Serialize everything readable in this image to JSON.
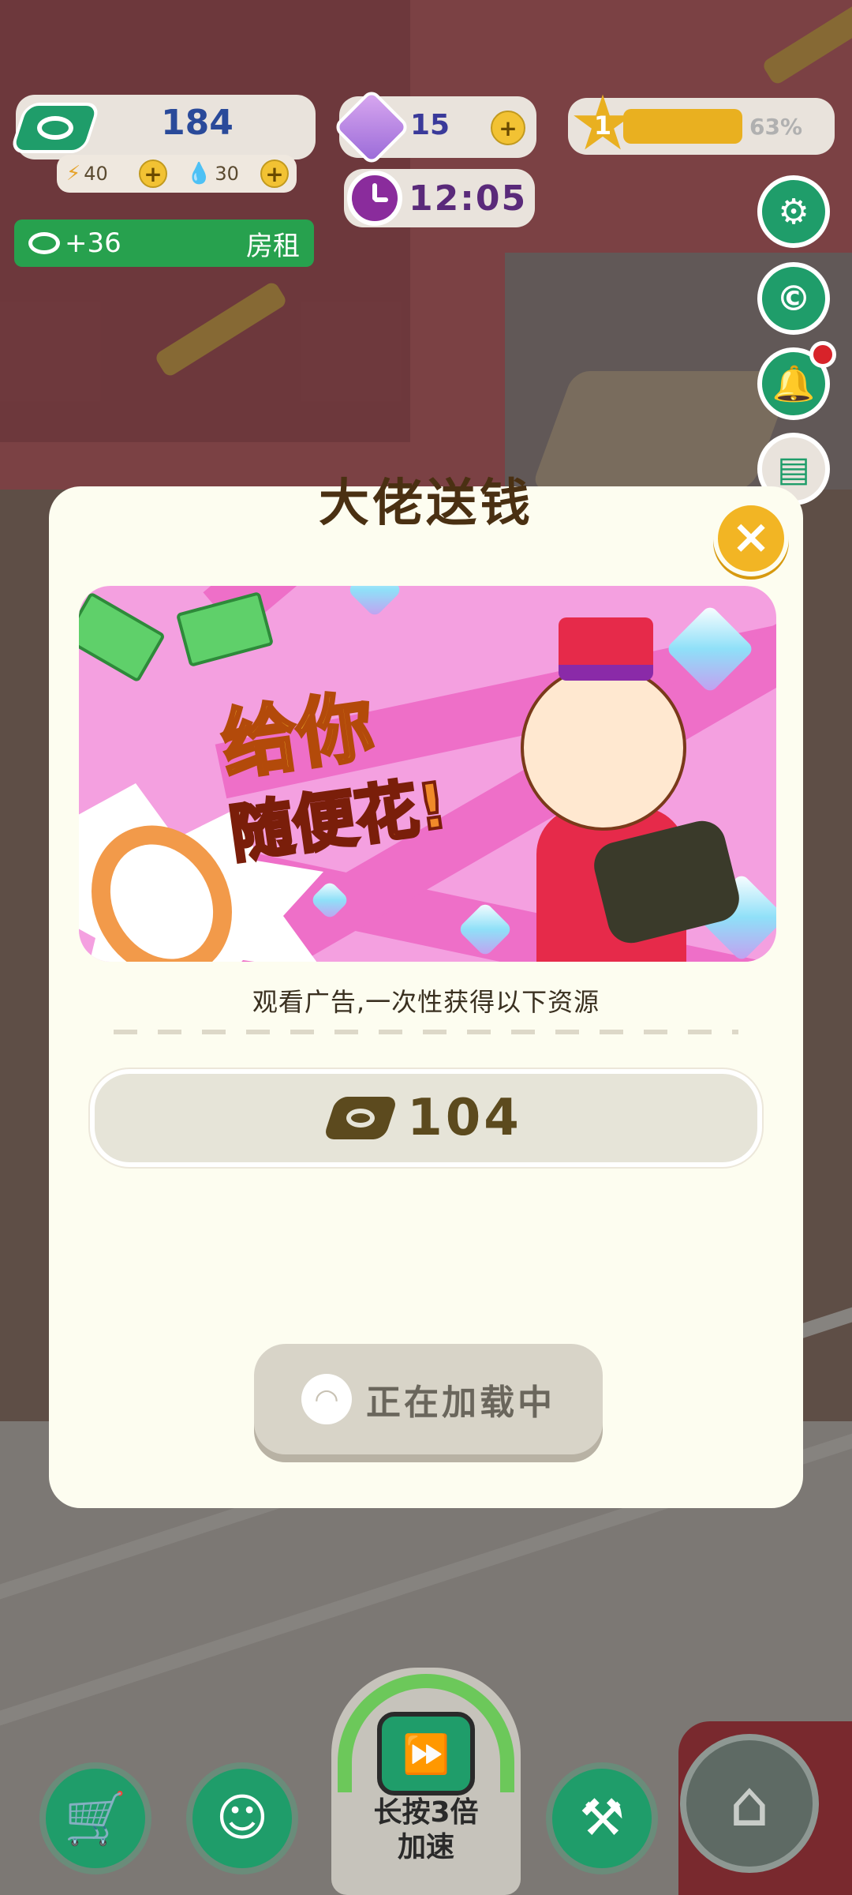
{
  "hud": {
    "money": "184",
    "energy": "40",
    "water": "30",
    "rent_income": "+36",
    "rent_label": "房租",
    "gems": "15",
    "clock": "12:05",
    "level": "1",
    "level_progress": 0.63,
    "level_percent": "63%"
  },
  "modal": {
    "title": "大佬送钱",
    "banner_line1": "给你",
    "banner_line2": "随便花!",
    "description": "观看广告,一次性获得以下资源",
    "reward_amount": "104",
    "loading_label": "正在加载中"
  },
  "bottom_bar": {
    "speed_label_line1": "长按3倍",
    "speed_label_line2": "加速"
  },
  "icons": {
    "money": "cash-icon",
    "energy": "lightning-icon",
    "water": "water-drop-icon",
    "gem": "diamond-icon",
    "clock": "clock-icon",
    "level": "star-icon",
    "settings": "gear-icon",
    "coin": "coin-icon",
    "bell": "bell-icon",
    "notes": "notebook-icon",
    "close": "close-icon",
    "shop": "cart-icon",
    "face": "smiley-icon",
    "tools": "tools-icon",
    "home": "home-icon",
    "tv": "tv-icon"
  },
  "colors": {
    "accent_green": "#1f9d6a",
    "gold": "#f2b524",
    "modal_bg": "#fdfdf0",
    "rent_green": "#27a14e"
  }
}
